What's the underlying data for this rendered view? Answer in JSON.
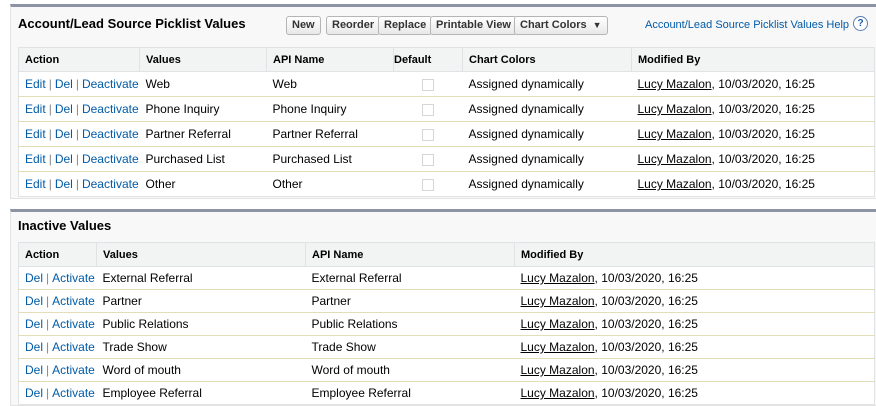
{
  "active": {
    "title": "Account/Lead Source Picklist Values",
    "buttons": {
      "new": "New",
      "reorder": "Reorder",
      "replace": "Replace",
      "printable_view": "Printable View",
      "chart_colors": "Chart Colors"
    },
    "help_link": "Account/Lead Source Picklist Values Help",
    "help_icon": "?",
    "columns": [
      "Action",
      "Values",
      "API Name",
      "Default",
      "Chart Colors",
      "Modified By"
    ],
    "action_labels": {
      "edit": "Edit",
      "del": "Del",
      "deactivate": "Deactivate",
      "sep": "|"
    },
    "rows": [
      {
        "value": "Web",
        "api_name": "Web",
        "default": false,
        "chart_color": "Assigned dynamically",
        "modified_user": "Lucy Mazalon",
        "modified_date": ", 10/03/2020, 16:25"
      },
      {
        "value": "Phone Inquiry",
        "api_name": "Phone Inquiry",
        "default": false,
        "chart_color": "Assigned dynamically",
        "modified_user": "Lucy Mazalon",
        "modified_date": ", 10/03/2020, 16:25"
      },
      {
        "value": "Partner Referral",
        "api_name": "Partner Referral",
        "default": false,
        "chart_color": "Assigned dynamically",
        "modified_user": "Lucy Mazalon",
        "modified_date": ", 10/03/2020, 16:25"
      },
      {
        "value": "Purchased List",
        "api_name": "Purchased List",
        "default": false,
        "chart_color": "Assigned dynamically",
        "modified_user": "Lucy Mazalon",
        "modified_date": ", 10/03/2020, 16:25"
      },
      {
        "value": "Other",
        "api_name": "Other",
        "default": false,
        "chart_color": "Assigned dynamically",
        "modified_user": "Lucy Mazalon",
        "modified_date": ", 10/03/2020, 16:25"
      }
    ]
  },
  "inactive": {
    "title": "Inactive Values",
    "columns": [
      "Action",
      "Values",
      "API Name",
      "Modified By"
    ],
    "action_labels": {
      "del": "Del",
      "activate": "Activate",
      "sep": "|"
    },
    "rows": [
      {
        "value": "External Referral",
        "api_name": "External Referral",
        "modified_user": "Lucy Mazalon",
        "modified_date": ", 10/03/2020, 16:25"
      },
      {
        "value": "Partner",
        "api_name": "Partner",
        "modified_user": "Lucy Mazalon",
        "modified_date": ", 10/03/2020, 16:25"
      },
      {
        "value": "Public Relations",
        "api_name": "Public Relations",
        "modified_user": "Lucy Mazalon",
        "modified_date": ", 10/03/2020, 16:25"
      },
      {
        "value": "Trade Show",
        "api_name": "Trade Show",
        "modified_user": "Lucy Mazalon",
        "modified_date": ", 10/03/2020, 16:25"
      },
      {
        "value": "Word of mouth",
        "api_name": "Word of mouth",
        "modified_user": "Lucy Mazalon",
        "modified_date": ", 10/03/2020, 16:25"
      },
      {
        "value": "Employee Referral",
        "api_name": "Employee Referral",
        "modified_user": "Lucy Mazalon",
        "modified_date": ", 10/03/2020, 16:25"
      }
    ]
  },
  "colors": {
    "link": "#015ba7",
    "panel_border": "#8d93a4",
    "header_bg": "#f2f3f3"
  }
}
